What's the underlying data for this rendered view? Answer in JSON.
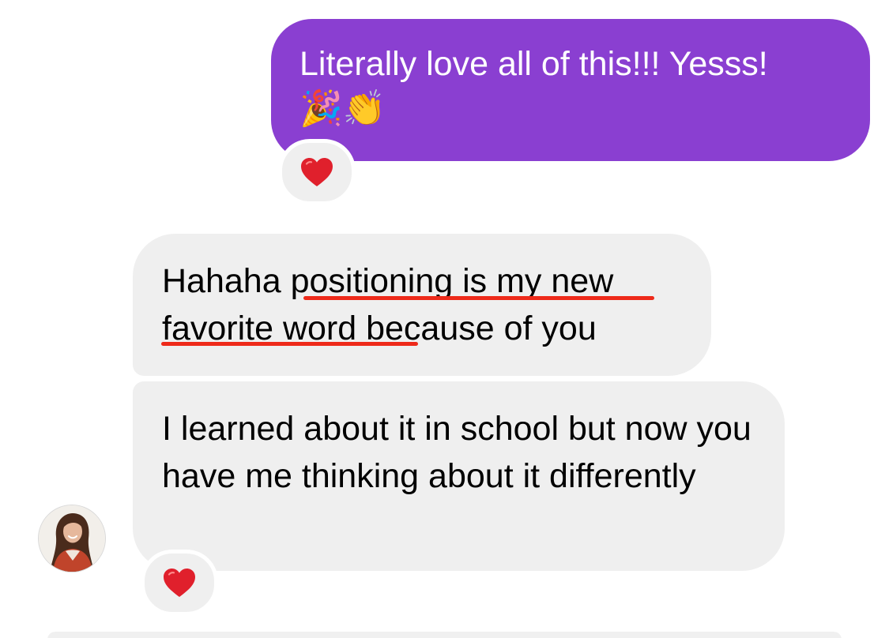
{
  "conversation": {
    "outgoing": {
      "text": "Literally love all of this!!! Yesss!",
      "emojis": "🎉👏",
      "reaction": "heart-icon"
    },
    "incoming": [
      {
        "text": "Hahaha positioning is my new favorite word because of you"
      },
      {
        "text": "I learned about it in school but now you have me thinking about it differently",
        "reaction": "heart-icon"
      }
    ],
    "sender_avatar": "profile-photo"
  },
  "colors": {
    "outgoing_bubble": "#8a3fd1",
    "incoming_bubble": "#efefef",
    "annotation_underline": "#ee2a1a",
    "heart": "#e0202c"
  }
}
